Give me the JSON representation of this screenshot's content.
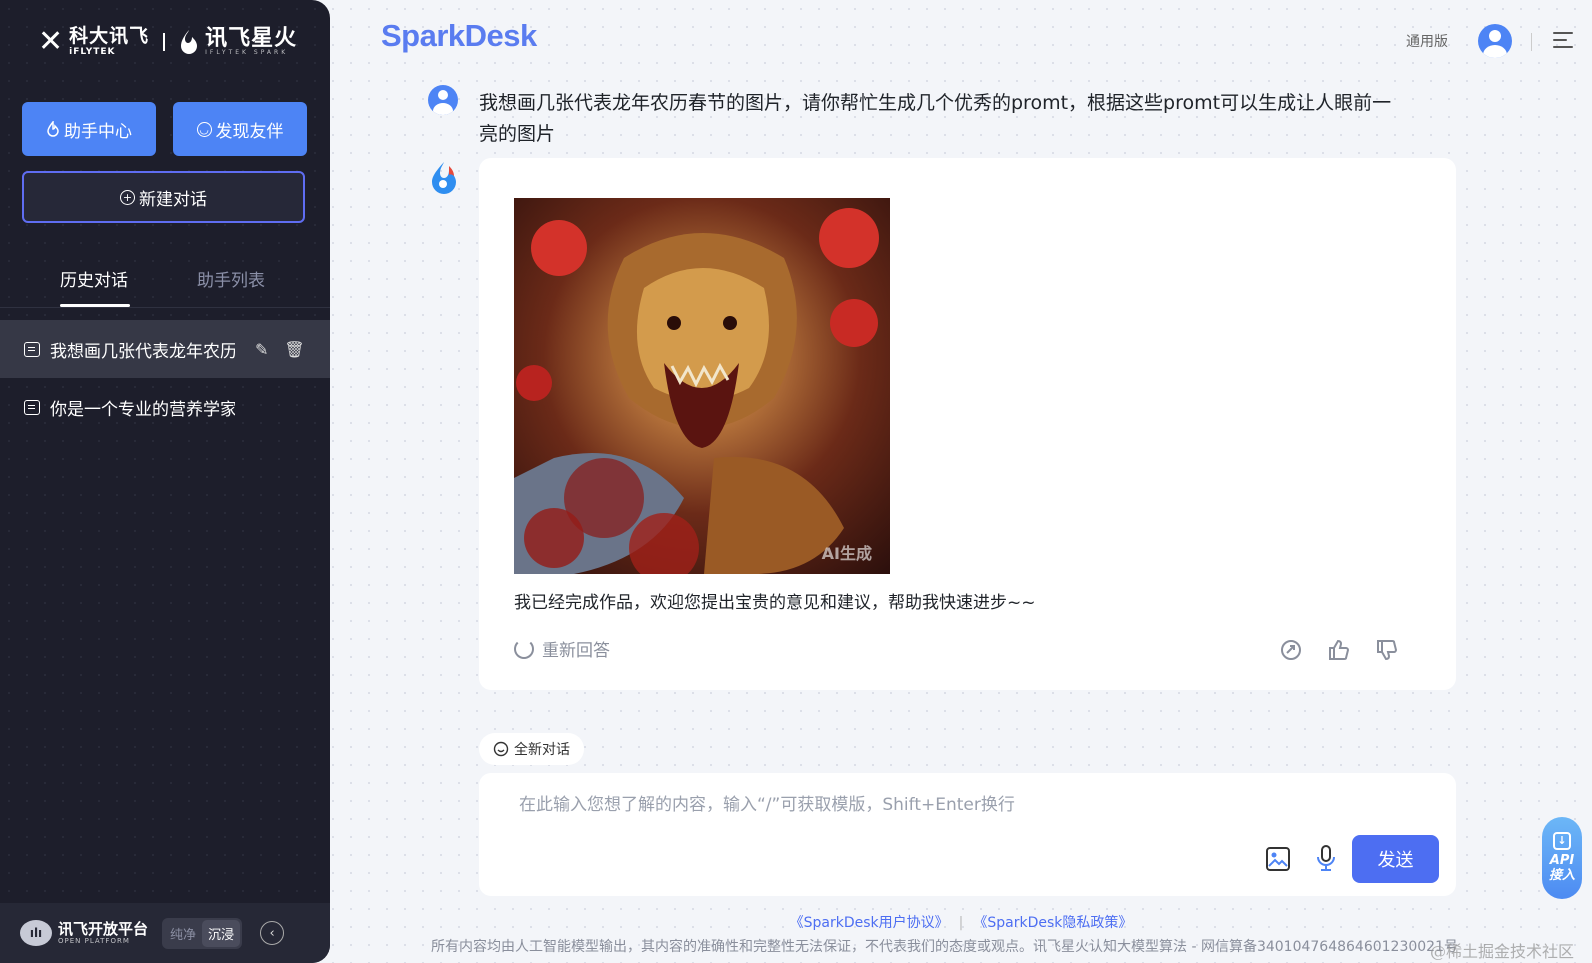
{
  "sidebar": {
    "brand_cn": "科大讯飞",
    "brand_en": "iFLYTEK",
    "brand_spark_cn": "讯飞星火",
    "brand_spark_en": "IFLYTEK SPARK",
    "assistant_center": "助手中心",
    "discover_partner": "发现友伴",
    "new_chat": "新建对话",
    "tabs": [
      {
        "label": "历史对话",
        "active": true
      },
      {
        "label": "助手列表",
        "active": false
      }
    ],
    "history": [
      {
        "label": "我想画几张代表龙年农历春节的图片，请你帮忙生成几个优秀的promt"
      },
      {
        "label": "你是一个专业的营养学家，请用"
      }
    ],
    "open_platform_cn": "讯飞开放平台",
    "open_platform_en": "OPEN PLATFORM",
    "mode_pure": "纯净",
    "mode_immersive": "沉浸"
  },
  "header": {
    "logo": "SparkDesk",
    "version": "通用版"
  },
  "conversation": {
    "user_message": "我想画几张代表龙年农历春节的图片，请你帮忙生成几个优秀的promt，根据这些promt可以生成让人眼前一亮的图片",
    "image_watermark": "AI生成",
    "answer_text": "我已经完成作品，欢迎您提出宝贵的意见和建议，帮助我快速进步~~",
    "regenerate": "重新回答"
  },
  "composer": {
    "new_chat_chip": "全新对话",
    "placeholder": "在此输入您想了解的内容，输入“/”可获取模版，Shift+Enter换行",
    "send": "发送"
  },
  "api_float": {
    "line1": "API",
    "line2": "接入"
  },
  "footer": {
    "agreement": "《SparkDesk用户协议》",
    "separator": "|",
    "privacy": "《SparkDesk隐私政策》",
    "note": "所有内容均由人工智能模型输出，其内容的准确性和完整性无法保证，不代表我们的态度或观点。讯飞星火认知大模型算法 - 网信算备340104764864601230021号",
    "watermark": "@稀土掘金技术社区"
  },
  "colors": {
    "accent": "#4d84f5",
    "send": "#4d6ef2",
    "sidebar_bg": "#1d1e2b",
    "new_chat_border": "#5f6df2"
  }
}
